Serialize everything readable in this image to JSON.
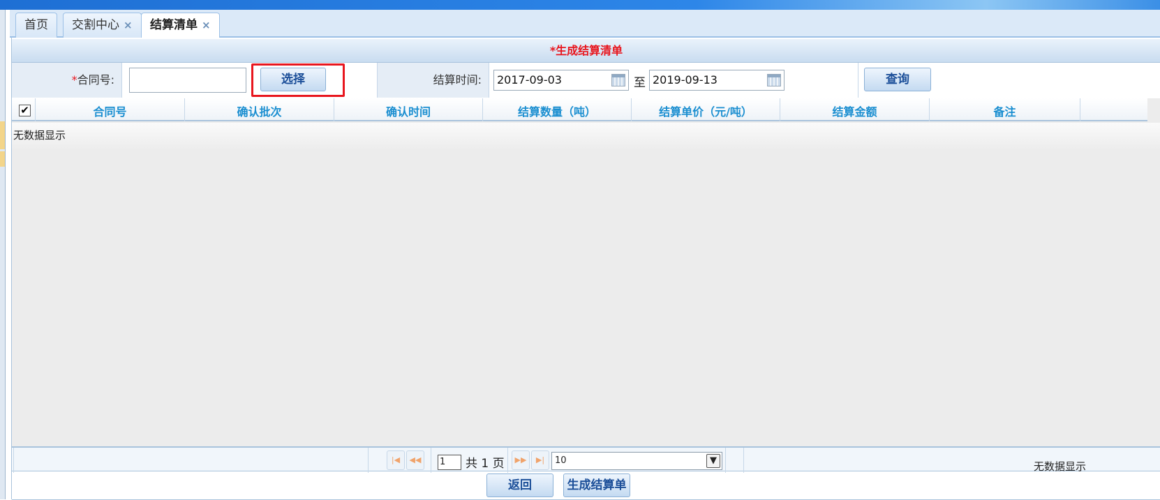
{
  "tabs": [
    {
      "label": "首页",
      "closable": false,
      "active": false
    },
    {
      "label": "交割中心",
      "closable": true,
      "active": false
    },
    {
      "label": "结算清单",
      "closable": true,
      "active": true
    }
  ],
  "tab_close_glyph": "×",
  "panel_title": "*生成结算清单",
  "form": {
    "contract_required_mark": "*",
    "contract_label": "合同号:",
    "contract_value": "",
    "select_button": "选择",
    "settle_time_label": "结算时间:",
    "date_from": "2017-09-03",
    "date_to_separator": "至",
    "date_to": "2019-09-13",
    "query_button": "查询"
  },
  "grid": {
    "select_all_checked": true,
    "check_glyph": "✔",
    "columns": [
      "合同号",
      "确认批次",
      "确认时间",
      "结算数量（吨）",
      "结算单价（元/吨）",
      "结算金额",
      "备注"
    ],
    "empty_text": "无数据显示"
  },
  "pager": {
    "first_glyph": "|◀",
    "prev_glyph": "◀◀",
    "next_glyph": "▶▶",
    "last_glyph": "▶|",
    "current_page": "1",
    "total_text": "共 1 页",
    "page_size": "10",
    "dropdown_glyph": "▼",
    "status_text": "无数据显示"
  },
  "actions": {
    "back_button": "返回",
    "generate_button": "生成结算单"
  },
  "colors": {
    "accent_red": "#e8161e",
    "header_blue": "#1a8ed0",
    "button_text": "#1c4f99"
  },
  "icons": [
    "calendar-icon",
    "check-icon",
    "first-page-icon",
    "prev-page-icon",
    "next-page-icon",
    "last-page-icon",
    "dropdown-arrow-icon",
    "close-icon"
  ]
}
